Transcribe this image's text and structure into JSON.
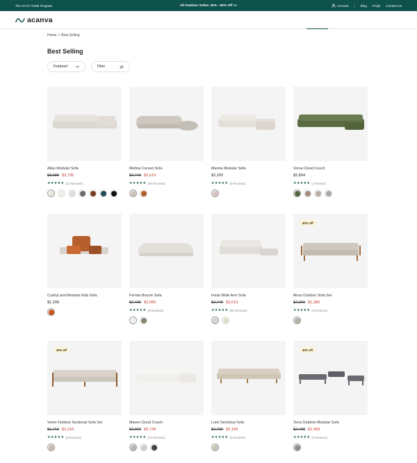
{
  "topbar": {
    "trade": "The ACVV Trade Program",
    "promo": "All Outdoor Sofas: 30% - 60% Off >>",
    "account": "Account",
    "sep": "|",
    "links": [
      "Blog",
      "FAQs",
      "Contact Us"
    ]
  },
  "brand": {
    "name": "acanva",
    "accent": "#0f524b"
  },
  "breadcrumb": {
    "home": "Home",
    "sep": ">",
    "current": "Best Selling"
  },
  "page": {
    "title": "Best Selling"
  },
  "controls": {
    "sort": "Featured",
    "filter": "Filter"
  },
  "products": [
    {
      "name": "Atlas Modular Sofa",
      "old": "$3,985",
      "price": "$3,795",
      "reviews": "(21 Reviews)",
      "badge": "",
      "swatches": [
        "#e9e6e0",
        "#f3f0ea",
        "#dedcd8",
        "#6b6b6b",
        "#7a3b22",
        "#1f4a57",
        "#111111"
      ]
    },
    {
      "name": "Mellow Curved Sofa",
      "old": "$2,749",
      "price": "$2,619",
      "reviews": "(59 Reviews)",
      "badge": "",
      "swatches": [
        "#c9c2b6",
        "#b0602d"
      ]
    },
    {
      "name": "Mareta Modular Sofa",
      "old": "",
      "price": "$2,292",
      "reviews": "(5 Reviews)",
      "badge": "",
      "swatches": [
        "#dcc4c2"
      ]
    },
    {
      "name": "Versa Cloud Couch",
      "old": "",
      "price": "$2,894",
      "reviews": "(1 Review)",
      "badge": "",
      "swatches": [
        "#55663e",
        "#a08b7e",
        "#b8b0a6",
        "#a9a9a6"
      ]
    },
    {
      "name": "CushyLand Modular Kids Sofa",
      "old": "",
      "price": "$1,299",
      "reviews": "",
      "badge": "",
      "swatches": [
        "#c8591f"
      ]
    },
    {
      "name": "Formia Boucle Sofa",
      "old": "$2,499",
      "price": "$2,099",
      "reviews": "(9 Reviews)",
      "badge": "",
      "swatches": [
        "#f1efeb",
        "#8c8171"
      ]
    },
    {
      "name": "Imola Wide Arm Sofa",
      "old": "$2,749",
      "price": "$2,619",
      "reviews": "(60 Reviews)",
      "badge": "",
      "swatches": [
        "#d6d3cf",
        "#dde3c8"
      ]
    },
    {
      "name": "Moss Outdoor Sofa Set",
      "old": "$2,269",
      "price": "$1,385",
      "reviews": "(6 Reviews)",
      "badge": "40% Off",
      "swatches": [
        "#b8b1a8"
      ]
    },
    {
      "name": "Vento Outdoor Sectional Sofa Set",
      "old": "$1,719",
      "price": "$1,154",
      "reviews": "(5 Reviews)",
      "badge": "40% off",
      "swatches": [
        "#c6bcae"
      ]
    },
    {
      "name": "Maven Cloud Couch",
      "old": "$2,969",
      "price": "$2,749",
      "reviews": "(10 Reviews)",
      "badge": "",
      "swatches": [
        "#b8b6b3",
        "#cfccc8",
        "#444444"
      ]
    },
    {
      "name": "Lumi Sectional Sofa",
      "old": "$2,799",
      "price": "$2,199",
      "reviews": "(3 Reviews)",
      "badge": "",
      "swatches": [
        "#cdc3b4"
      ]
    },
    {
      "name": "Terra Outdoor Modular Sofa",
      "old": "$2,499",
      "price": "$1,499",
      "reviews": "(2 Reviews)",
      "badge": "40% off",
      "swatches": [
        "#8e8e93"
      ]
    }
  ]
}
